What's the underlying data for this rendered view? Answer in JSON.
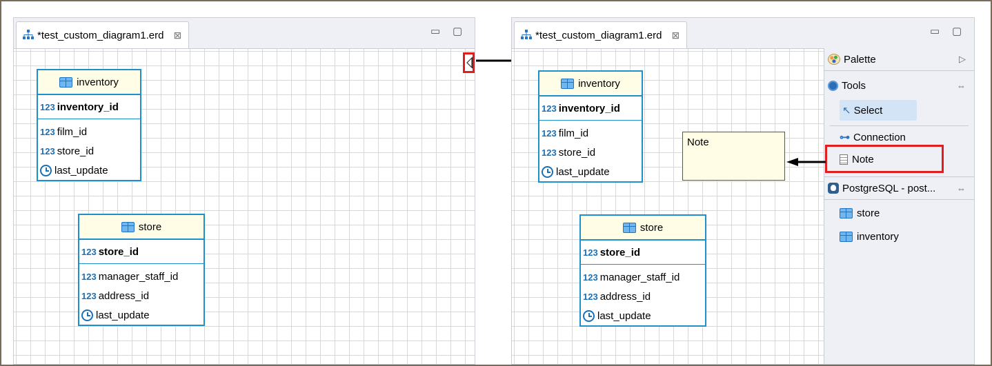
{
  "left_panel": {
    "tab_title": "*test_custom_diagram1.erd",
    "tab_close": "⊠",
    "minimize": "▭",
    "maximize": "▢",
    "inventory": {
      "name": "inventory",
      "pk_type": "123",
      "pk": "inventory_id",
      "attrs": [
        {
          "type": "123",
          "name": "film_id"
        },
        {
          "type": "123",
          "name": "store_id"
        },
        {
          "type": "clock",
          "name": "last_update"
        }
      ]
    },
    "store": {
      "name": "store",
      "pk_type": "123",
      "pk": "store_id",
      "attrs": [
        {
          "type": "123",
          "name": "manager_staff_id"
        },
        {
          "type": "123",
          "name": "address_id"
        },
        {
          "type": "clock",
          "name": "last_update"
        }
      ]
    }
  },
  "right_panel": {
    "tab_title": "*test_custom_diagram1.erd",
    "tab_close": "⊠",
    "minimize": "▭",
    "maximize": "▢",
    "note_text": "Note",
    "inventory": {
      "name": "inventory",
      "pk_type": "123",
      "pk": "inventory_id",
      "attrs": [
        {
          "type": "123",
          "name": "film_id"
        },
        {
          "type": "123",
          "name": "store_id"
        },
        {
          "type": "clock",
          "name": "last_update"
        }
      ]
    },
    "store": {
      "name": "store",
      "pk_type": "123",
      "pk": "store_id",
      "attrs": [
        {
          "type": "123",
          "name": "manager_staff_id"
        },
        {
          "type": "123",
          "name": "address_id"
        },
        {
          "type": "clock",
          "name": "last_update"
        }
      ]
    },
    "palette": {
      "title": "Palette",
      "collapse_glyph": "▷",
      "tools_label": "Tools",
      "section_glyph": "⇔",
      "select_label": "Select",
      "connection_label": "Connection",
      "note_label": "Note",
      "db_section_label": "PostgreSQL - post...",
      "db_items": [
        "store",
        "inventory"
      ]
    }
  },
  "colors": {
    "entity_border": "#1e8fca",
    "entity_header_bg": "#fffde6",
    "highlight": "#e21d1d",
    "select_bg": "#d3e4f7"
  }
}
